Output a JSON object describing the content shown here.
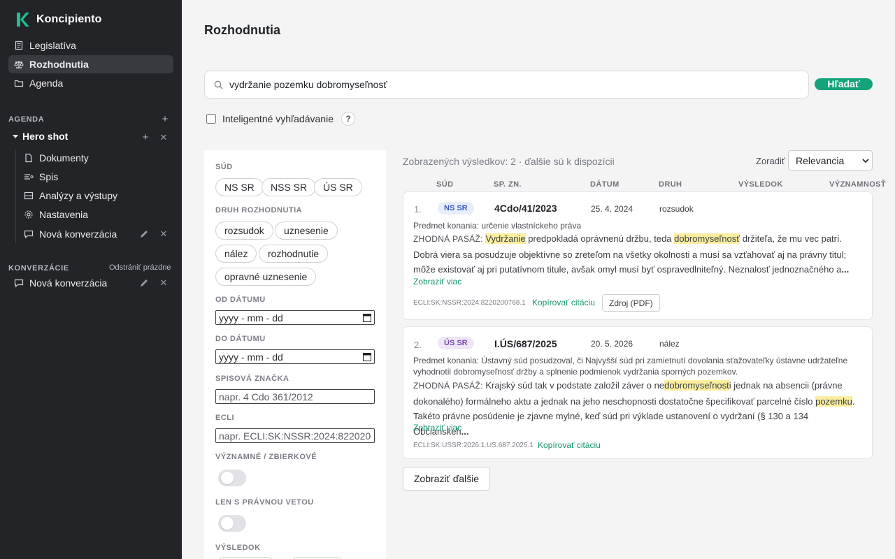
{
  "app": {
    "name": "Koncipiento"
  },
  "sidebar": {
    "nav": [
      {
        "label": "Legislatíva",
        "icon": "document-icon"
      },
      {
        "label": "Rozhodnutia",
        "icon": "scales-icon",
        "active": true
      },
      {
        "label": "Agenda",
        "icon": "folder-icon"
      }
    ],
    "agenda_label": "AGENDA",
    "group": {
      "title": "Hero shot",
      "items": [
        {
          "label": "Dokumenty",
          "icon": "file-icon"
        },
        {
          "label": "Spis",
          "icon": "list-icon"
        },
        {
          "label": "Analýzy a výstupy",
          "icon": "table-icon"
        },
        {
          "label": "Nastavenia",
          "icon": "gear-icon"
        },
        {
          "label": "Nová konverzácia",
          "icon": "chat-icon"
        }
      ]
    },
    "conversations_label": "KONVERZÁCIE",
    "remove_empty": "Odstrániť prázdne",
    "conversation": "Nová konverzácia"
  },
  "main": {
    "title": "Rozhodnutia",
    "search": {
      "value": "vydržanie pozemku dobromyseľnosť",
      "button": "Hľadať"
    },
    "smart_search": {
      "label": "Inteligentné vyhľadávanie",
      "checked": false,
      "help": "?"
    }
  },
  "filters": {
    "court_label": "SÚD",
    "courts": [
      "NS SR",
      "NSS SR",
      "ÚS SR"
    ],
    "type_label": "DRUH ROZHODNUTIA",
    "types": [
      "rozsudok",
      "uznesenie",
      "nález",
      "rozhodnutie",
      "opravné uznesenie"
    ],
    "from_label": "OD DÁTUMU",
    "to_label": "DO DÁTUMU",
    "date_placeholder": "yyyy - mm - dd",
    "file_label": "SPISOVÁ ZNAČKA",
    "file_placeholder": "napr. 4 Cdo 361/2012",
    "ecli_label": "ECLI",
    "ecli_placeholder": "napr. ECLI:SK:NSSR:2024:8220200768.1",
    "significant_label": "VÝZNAMNÉ / ZBIERKOVÉ",
    "significant_on": false,
    "veto_label": "LEN S PRÁVNOU VETOU",
    "veto_on": false,
    "result_label": "VÝSLEDOK"
  },
  "results": {
    "count_text": "Zobrazených výsledkov: 2 · ďalšie sú k dispozícii",
    "sort_label": "Zoradiť",
    "sort_value": "Relevancia",
    "columns": [
      "SÚD",
      "SP. ZN.",
      "DÁTUM",
      "DRUH",
      "VÝSLEDOK",
      "VÝZNAMNOSŤ"
    ],
    "show_more": "Zobraziť viac",
    "copy_citation": "Kopírovať citáciu",
    "source_button": "Zdroj (PDF)",
    "load_more": "Zobraziť ďalšie",
    "items": [
      {
        "num": "1.",
        "court": "NS SR",
        "file_no": "4Cdo/41/2023",
        "date": "25. 4. 2024",
        "kind": "rozsudok",
        "subject": "Predmet konania: určenie vlastníckeho práva",
        "passage_label": "ZHODNÁ PASÁŽ:",
        "passage_segments": [
          {
            "t": "Vydržanie",
            "hl": true
          },
          {
            "t": " predpokladá oprávnenú držbu, teda ",
            "hl": false
          },
          {
            "t": "dobromyseľnosť",
            "hl": true
          },
          {
            "t": " držiteľa, že mu vec patrí. Dobrá viera sa posudzuje objektívne so zreteľom na všetky okolnosti a musí sa vzťahovať aj na právny titul; môže existovať aj pri putatívnom titule, avšak omyl musí byť ospravedlniteľný. Neznalosť jednoznačného a",
            "hl": false
          },
          {
            "t": "...",
            "hl": false
          }
        ],
        "ecli": "ECLI:SK:NSSR:2024:8220200768.1"
      },
      {
        "num": "2.",
        "court": "ÚS SR",
        "file_no": "I.ÚS/687/2025",
        "date": "20. 5. 2026",
        "kind": "nález",
        "subject": "Predmet konania: Ústavný súd posudzoval, či Najvyšší súd pri zamietnutí dovolania sťažovateľky ústavne udržateľne vyhodnotil dobromyseľnosť držby a splnenie podmienok vydržania sporných pozemkov.",
        "passage_label": "ZHODNÁ PASÁŽ:",
        "passage_segments": [
          {
            "t": " Krajský súd tak v podstate založil záver o ne",
            "hl": false
          },
          {
            "t": "dobromyseľnost",
            "hl": true
          },
          {
            "t": "i jednak na absencii (právne dokonalého) formálneho aktu a jednak na jeho neschopnosti dostatočne špecifikovať parcelné číslo ",
            "hl": false
          },
          {
            "t": "pozemku",
            "hl": true
          },
          {
            "t": ". Takéto právne posúdenie je zjavne mylné, keď súd pri výklade ustanovení o vydržaní (§ 130 a 134 Občianskeh",
            "hl": false
          },
          {
            "t": "...",
            "hl": false
          }
        ],
        "ecli": "ECLI:SK:USSR:2026:1.US.687.2025.1"
      }
    ]
  },
  "colors": {
    "accent": "#14a37a",
    "sidebar_bg": "#232428",
    "highlight": "#fbeea0"
  }
}
